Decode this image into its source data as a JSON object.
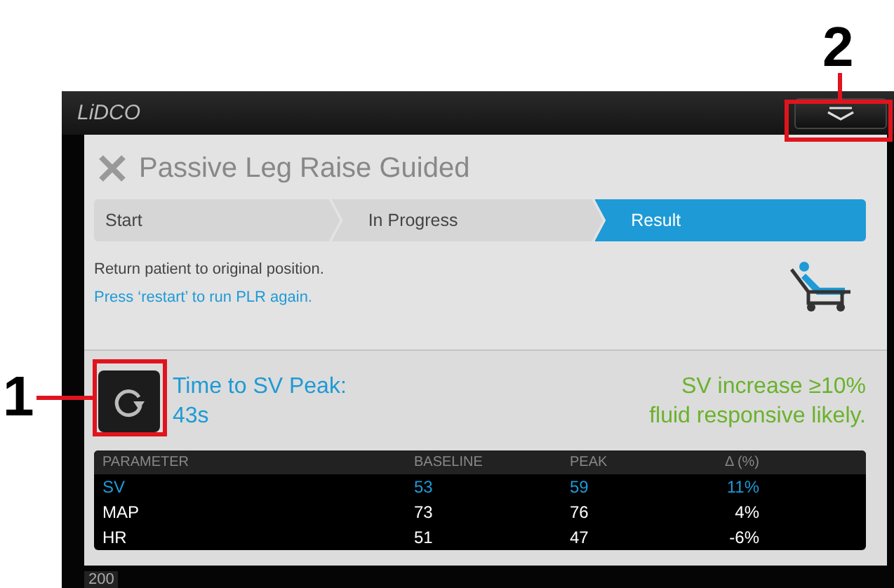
{
  "callouts": [
    {
      "label": "1"
    },
    {
      "label": "2"
    }
  ],
  "window": {
    "brand": "LiDCO"
  },
  "dialog": {
    "title": "Passive Leg Raise Guided",
    "steps": [
      {
        "label": "Start",
        "selected": false
      },
      {
        "label": "In Progress",
        "selected": false
      },
      {
        "label": "Result",
        "selected": true
      }
    ],
    "instruction": "Return patient to original position.",
    "hint": "Press ‘restart’ to run PLR again.",
    "time_label": "Time to SV Peak:",
    "time_value": "43s",
    "result_lines": [
      "SV increase ≥10%",
      "fluid responsive likely."
    ],
    "table": {
      "columns": [
        "PARAMETER",
        "BASELINE",
        "PEAK",
        "Δ (%)"
      ],
      "rows": [
        {
          "cells": [
            "SV",
            "53",
            "59",
            "11%"
          ],
          "highlighted": true
        },
        {
          "cells": [
            "MAP",
            "73",
            "76",
            "4%"
          ],
          "highlighted": false
        },
        {
          "cells": [
            "HR",
            "51",
            "47",
            "-6%"
          ],
          "highlighted": false
        }
      ]
    }
  },
  "status_bar": {
    "value": "200"
  }
}
